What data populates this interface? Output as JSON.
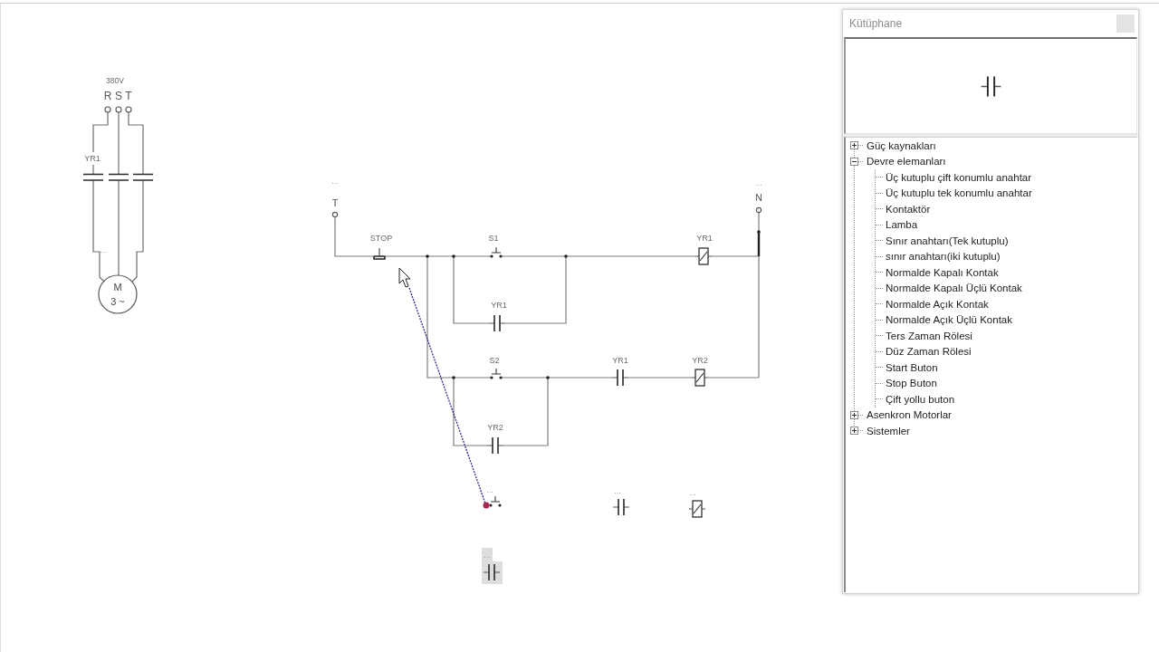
{
  "canvas": {
    "power_circuit": {
      "voltage": "380V",
      "phases": [
        "R",
        "S",
        "T"
      ],
      "contactor_label": "YR1",
      "feed_label": "...",
      "motor": {
        "name": "M",
        "phase_note": "3 ~"
      }
    },
    "control_circuit": {
      "terminals": [
        {
          "name": "T",
          "label": "..."
        },
        {
          "name": "N",
          "label": "..."
        }
      ],
      "components": [
        {
          "kind": "push_button_nc",
          "label": "STOP",
          "selected": false
        },
        {
          "kind": "push_button_no",
          "label": "S1",
          "selected": false
        },
        {
          "kind": "coil",
          "label": "YR1",
          "selected": false
        },
        {
          "kind": "contact_no",
          "label": "YR1",
          "selected": false
        },
        {
          "kind": "push_button_no",
          "label": "S2",
          "selected": false
        },
        {
          "kind": "contact_no",
          "label": "YR1",
          "selected": false
        },
        {
          "kind": "coil",
          "label": "YR2",
          "selected": false
        },
        {
          "kind": "contact_no",
          "label": "YR2",
          "selected": false
        }
      ]
    },
    "loose_parts": [
      {
        "kind": "push_button_no",
        "label": "...",
        "selected": false
      },
      {
        "kind": "contact_no",
        "label": "...",
        "selected": false
      },
      {
        "kind": "coil",
        "label": "...",
        "selected": false
      },
      {
        "kind": "contact_no",
        "label": "...",
        "selected": true
      }
    ]
  },
  "library_panel": {
    "title": "Kütüphane",
    "preview": {
      "kind": "contact_no"
    },
    "tree": [
      {
        "label": "Güç kaynakları",
        "expanded": false,
        "selected": false
      },
      {
        "label": "Devre elemanları",
        "expanded": true,
        "selected": false,
        "children": [
          {
            "label": "Üç kutuplu çift konumlu anahtar",
            "selected": false
          },
          {
            "label": "Üç kutuplu tek konumlu anahtar",
            "selected": false
          },
          {
            "label": "Kontaktör",
            "selected": false
          },
          {
            "label": "Lamba",
            "selected": false
          },
          {
            "label": "Sınır anahtarı(Tek kutuplu)",
            "selected": false
          },
          {
            "label": "sınır anahtarı(iki kutuplu)",
            "selected": false
          },
          {
            "label": "Normalde Kapalı Kontak",
            "selected": false
          },
          {
            "label": "Normalde Kapalı Üçlü Kontak",
            "selected": false
          },
          {
            "label": "Normalde Açık Kontak",
            "selected": false
          },
          {
            "label": "Normalde Açık Üçlü Kontak",
            "selected": false
          },
          {
            "label": "Ters Zaman Rölesi",
            "selected": false
          },
          {
            "label": "Düz Zaman Rölesi",
            "selected": false
          },
          {
            "label": "Start Buton",
            "selected": false
          },
          {
            "label": "Stop Buton",
            "selected": false
          },
          {
            "label": "Çift yollu buton",
            "selected": false
          }
        ]
      },
      {
        "label": "Asenkron Motorlar",
        "expanded": false,
        "selected": false
      },
      {
        "label": "Sistemler",
        "expanded": false,
        "selected": false
      }
    ]
  }
}
